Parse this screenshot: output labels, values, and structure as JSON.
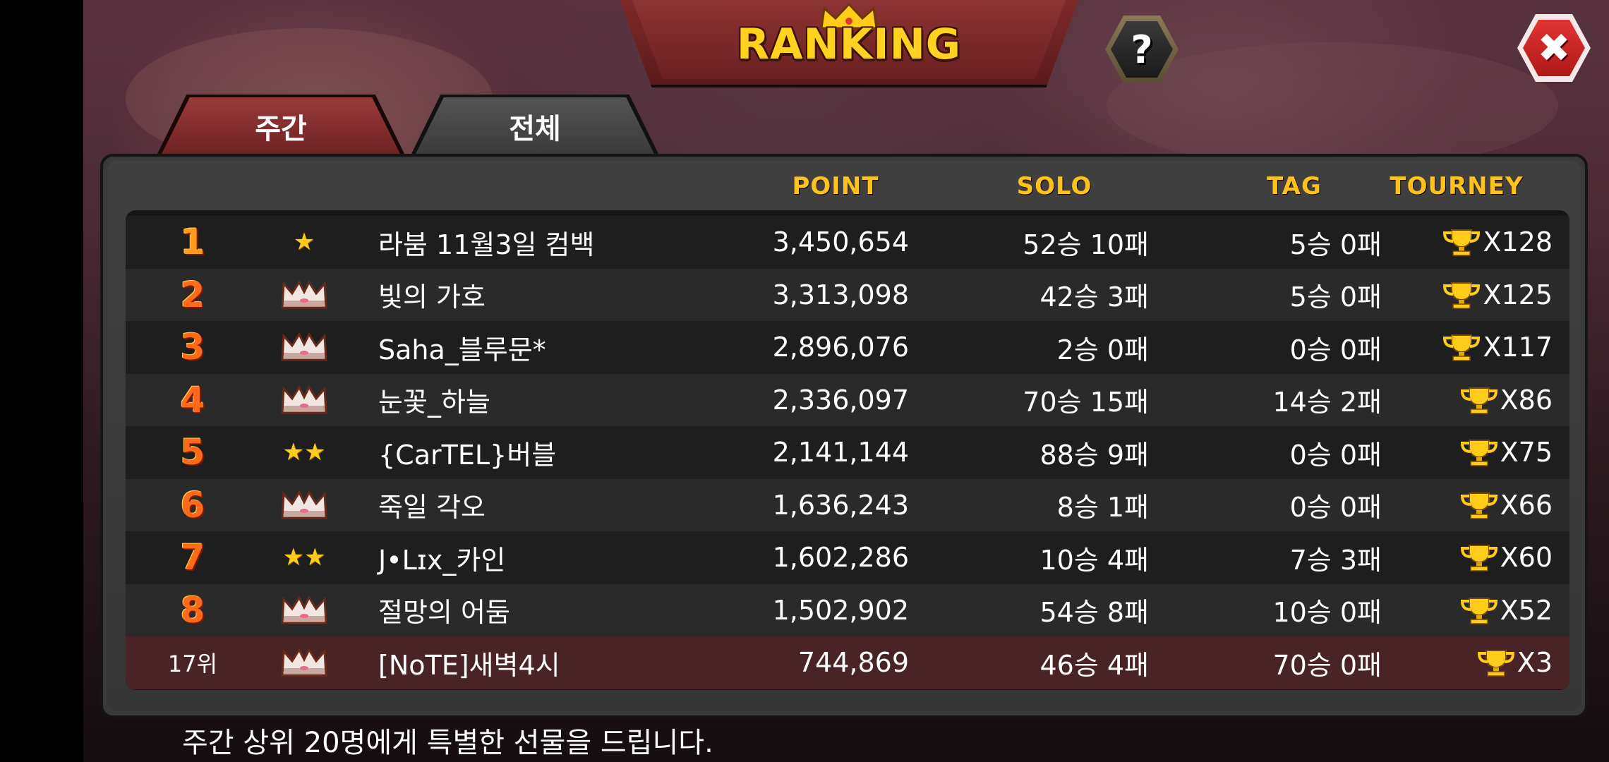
{
  "header": {
    "title": "RANKING",
    "help_label": "?",
    "close_label": "✖"
  },
  "tabs": [
    {
      "label": "주간",
      "active": true
    },
    {
      "label": "전체",
      "active": false
    }
  ],
  "columns": {
    "point": "POINT",
    "solo": "SOLO",
    "tag": "TAG",
    "tourney": "TOURNEY"
  },
  "rows": [
    {
      "rank": "1",
      "badge": "star-1",
      "name": "라붐 11월3일 컴백",
      "point": "3,450,654",
      "solo": "52승 10패",
      "tag": "5승 0패",
      "tourney": "X128"
    },
    {
      "rank": "2",
      "badge": "crown",
      "name": "빛의 가호",
      "point": "3,313,098",
      "solo": "42승 3패",
      "tag": "5승 0패",
      "tourney": "X125"
    },
    {
      "rank": "3",
      "badge": "crown",
      "name": "Saha_블루문*",
      "point": "2,896,076",
      "solo": "2승 0패",
      "tag": "0승 0패",
      "tourney": "X117"
    },
    {
      "rank": "4",
      "badge": "crown",
      "name": "눈꽃_하늘",
      "point": "2,336,097",
      "solo": "70승 15패",
      "tag": "14승 2패",
      "tourney": "X86"
    },
    {
      "rank": "5",
      "badge": "star-2",
      "name": "{CarTEL}버블",
      "point": "2,141,144",
      "solo": "88승 9패",
      "tag": "0승 0패",
      "tourney": "X75"
    },
    {
      "rank": "6",
      "badge": "crown",
      "name": "죽일 각오",
      "point": "1,636,243",
      "solo": "8승 1패",
      "tag": "0승 0패",
      "tourney": "X66"
    },
    {
      "rank": "7",
      "badge": "star-2",
      "name": "J•Lɪx_카인",
      "point": "1,602,286",
      "solo": "10승 4패",
      "tag": "7승 3패",
      "tourney": "X60"
    },
    {
      "rank": "8",
      "badge": "crown",
      "name": "절망의 어둠",
      "point": "1,502,902",
      "solo": "54승 8패",
      "tag": "10승 0패",
      "tourney": "X52"
    },
    {
      "rank": "17위",
      "badge": "crown",
      "name": "[NoTE]새벽4시",
      "point": "744,869",
      "solo": "46승 4패",
      "tag": "70승 0패",
      "tourney": "X3",
      "is_me": true
    }
  ],
  "footer": {
    "text": "주간 상위 20명에게 특별한 선물을 드립니다."
  },
  "colors": {
    "accent_gold": "#ffc21a",
    "rank_orange": "#ff6a1a",
    "highlight_row": "#4a2326",
    "close_red": "#d42626"
  }
}
